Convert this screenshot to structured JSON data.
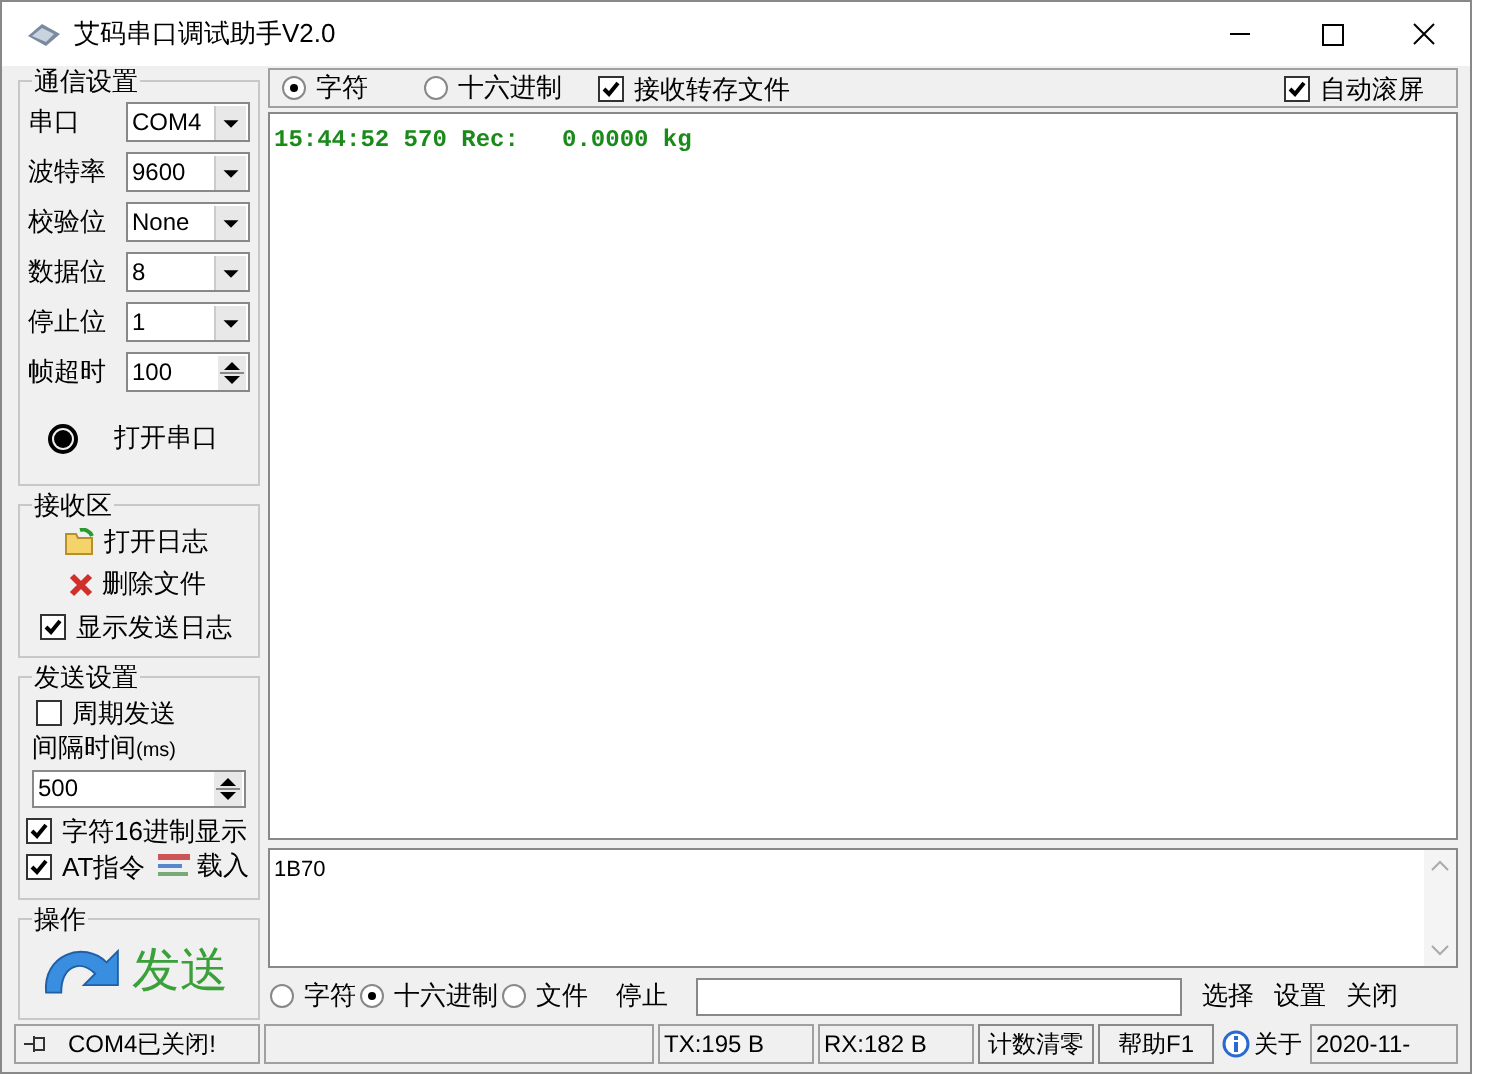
{
  "window": {
    "title": "艾码串口调试助手V2.0"
  },
  "comm_settings": {
    "title": "通信设置",
    "fields": [
      {
        "label": "串口",
        "kind": "select",
        "value": "COM4"
      },
      {
        "label": "波特率",
        "kind": "select",
        "value": "9600"
      },
      {
        "label": "校验位",
        "kind": "select",
        "value": "None"
      },
      {
        "label": "数据位",
        "kind": "select",
        "value": "8"
      },
      {
        "label": "停止位",
        "kind": "select",
        "value": "1"
      },
      {
        "label": "帧超时",
        "kind": "spin",
        "value": "100"
      }
    ],
    "open_port": {
      "label": "打开串口",
      "on": true
    }
  },
  "receive_area": {
    "title": "接收区",
    "open_log": "打开日志",
    "delete_file": "删除文件",
    "show_send_log": {
      "label": "显示发送日志",
      "checked": true
    }
  },
  "send_settings": {
    "title": "发送设置",
    "periodic": {
      "label": "周期发送",
      "checked": false
    },
    "interval_label": "间隔时间",
    "interval_unit": "(ms)",
    "interval_value": "500",
    "hex_display": {
      "label": "字符16进制显示",
      "checked": true
    },
    "at_command": {
      "label": "AT指令",
      "checked": true
    },
    "load": "载入"
  },
  "operation": {
    "title": "操作",
    "send": "发送"
  },
  "receive_toolbar": {
    "modes": [
      {
        "label": "字符",
        "selected": true
      },
      {
        "label": "十六进制",
        "selected": false
      }
    ],
    "save_to_file": {
      "label": "接收转存文件",
      "checked": true
    },
    "auto_scroll": {
      "label": "自动滚屏",
      "checked": true
    }
  },
  "receive_text": "15:44:52 570 Rec:   0.0000 kg",
  "send_text": "1B70",
  "send_bar": {
    "modes": [
      {
        "label": "字符",
        "selected": false
      },
      {
        "label": "十六进制",
        "selected": true
      },
      {
        "label": "文件",
        "selected": false
      }
    ],
    "stop": "停止",
    "buttons": [
      "选择",
      "设置",
      "关闭"
    ]
  },
  "status_bar": {
    "port_status": "COM4已关闭!",
    "tx": "TX:195 B",
    "rx": "RX:182 B",
    "clear_button": "计数清零",
    "help_button": "帮助F1",
    "about": "关于",
    "date": "2020-11-"
  }
}
